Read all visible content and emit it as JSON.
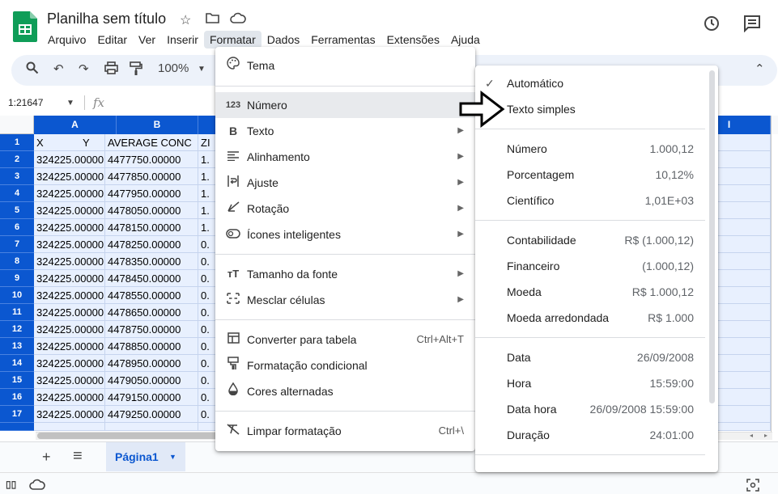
{
  "app": {
    "title": "Planilha sem título",
    "menus": [
      "Arquivo",
      "Editar",
      "Ver",
      "Inserir",
      "Formatar",
      "Dados",
      "Ferramentas",
      "Extensões",
      "Ajuda"
    ]
  },
  "toolbar": {
    "zoom": "100%"
  },
  "formula_bar": {
    "name_box": "1:21647",
    "fx": "fx"
  },
  "grid": {
    "columns": [
      "A",
      "B",
      "I"
    ],
    "header_row": {
      "a": "X",
      "a2": "Y",
      "b": "AVERAGE CONC",
      "c": "ZI"
    },
    "rows": [
      {
        "n": "1"
      },
      {
        "n": "2",
        "a": "324225.00000",
        "b": "4477750.00000",
        "c": "1."
      },
      {
        "n": "3",
        "a": "324225.00000",
        "b": "4477850.00000",
        "c": "1."
      },
      {
        "n": "4",
        "a": "324225.00000",
        "b": "4477950.00000",
        "c": "1."
      },
      {
        "n": "5",
        "a": "324225.00000",
        "b": "4478050.00000",
        "c": "1."
      },
      {
        "n": "6",
        "a": "324225.00000",
        "b": "4478150.00000",
        "c": "1."
      },
      {
        "n": "7",
        "a": "324225.00000",
        "b": "4478250.00000",
        "c": "0."
      },
      {
        "n": "8",
        "a": "324225.00000",
        "b": "4478350.00000",
        "c": "0."
      },
      {
        "n": "9",
        "a": "324225.00000",
        "b": "4478450.00000",
        "c": "0."
      },
      {
        "n": "10",
        "a": "324225.00000",
        "b": "4478550.00000",
        "c": "0."
      },
      {
        "n": "11",
        "a": "324225.00000",
        "b": "4478650.00000",
        "c": "0."
      },
      {
        "n": "12",
        "a": "324225.00000",
        "b": "4478750.00000",
        "c": "0."
      },
      {
        "n": "13",
        "a": "324225.00000",
        "b": "4478850.00000",
        "c": "0."
      },
      {
        "n": "14",
        "a": "324225.00000",
        "b": "4478950.00000",
        "c": "0."
      },
      {
        "n": "15",
        "a": "324225.00000",
        "b": "4479050.00000",
        "c": "0."
      },
      {
        "n": "16",
        "a": "324225.00000",
        "b": "4479150.00000",
        "c": "0."
      },
      {
        "n": "17",
        "a": "324225.00000",
        "b": "4479250.00000",
        "c": "0."
      }
    ]
  },
  "sheets": {
    "active": "Página1",
    "add": "+",
    "list": "≡"
  },
  "format_menu": {
    "items": [
      {
        "icon": "palette-icon",
        "label": "Tema"
      },
      {
        "icon": "number-icon",
        "label": "Número"
      },
      {
        "icon": "bold-icon",
        "label": "Texto"
      },
      {
        "icon": "align-icon",
        "label": "Alinhamento"
      },
      {
        "icon": "wrap-icon",
        "label": "Ajuste"
      },
      {
        "icon": "rotate-icon",
        "label": "Rotação"
      },
      {
        "icon": "smart-chips-icon",
        "label": "Ícones inteligentes"
      },
      {
        "icon": "font-size-icon",
        "label": "Tamanho da fonte"
      },
      {
        "icon": "merge-icon",
        "label": "Mesclar células"
      },
      {
        "icon": "table-icon",
        "label": "Converter para tabela",
        "shortcut": "Ctrl+Alt+T"
      },
      {
        "icon": "conditional-format-icon",
        "label": "Formatação condicional"
      },
      {
        "icon": "alternating-colors-icon",
        "label": "Cores alternadas"
      },
      {
        "icon": "clear-format-icon",
        "label": "Limpar formatação",
        "shortcut": "Ctrl+\\"
      }
    ]
  },
  "number_submenu": {
    "items": [
      {
        "label": "Automático",
        "example": "",
        "checked": true
      },
      {
        "label": "Texto simples",
        "example": ""
      },
      {
        "label": "Número",
        "example": "1.000,12"
      },
      {
        "label": "Porcentagem",
        "example": "10,12%"
      },
      {
        "label": "Científico",
        "example": "1,01E+03"
      },
      {
        "label": "Contabilidade",
        "example": "R$ (1.000,12)"
      },
      {
        "label": "Financeiro",
        "example": "(1.000,12)"
      },
      {
        "label": "Moeda",
        "example": "R$ 1.000,12"
      },
      {
        "label": "Moeda arredondada",
        "example": "R$ 1.000"
      },
      {
        "label": "Data",
        "example": "26/09/2008"
      },
      {
        "label": "Hora",
        "example": "15:59:00"
      },
      {
        "label": "Data hora",
        "example": "26/09/2008 15:59:00"
      },
      {
        "label": "Duração",
        "example": "24:01:00"
      }
    ]
  },
  "colors": {
    "accent": "#0b57d0",
    "selection": "#e8f0fe"
  }
}
